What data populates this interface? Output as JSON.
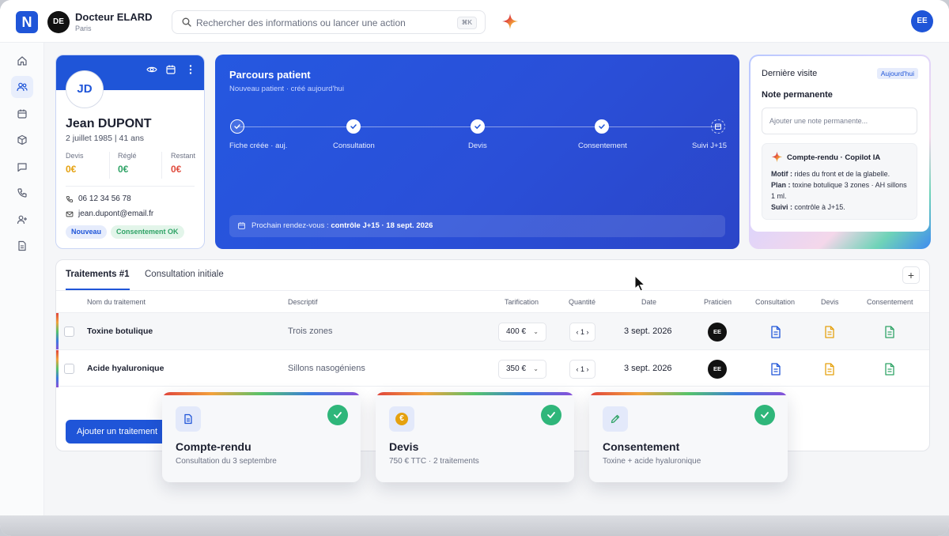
{
  "header": {
    "logo_letter": "N",
    "doctor_initials": "DE",
    "doctor_name": "Docteur ELARD",
    "doctor_city": "Paris",
    "search_placeholder": "Rechercher des informations ou lancer une action",
    "search_shortcut": "⌘K",
    "user_initials": "EE"
  },
  "sidebar": {
    "items": [
      {
        "icon": "home-icon"
      },
      {
        "icon": "users-icon",
        "active": true
      },
      {
        "icon": "calendar-icon"
      },
      {
        "icon": "box-icon"
      },
      {
        "icon": "chat-icon"
      },
      {
        "icon": "phone-icon"
      },
      {
        "icon": "user-plus-icon"
      },
      {
        "icon": "document-icon"
      }
    ]
  },
  "patient": {
    "initials": "JD",
    "name": "Jean DUPONT",
    "dob_age": "2 juillet 1985 | 41 ans",
    "stats": [
      {
        "label": "Devis",
        "value": "0€",
        "color": "#e5a10f"
      },
      {
        "label": "Réglé",
        "value": "0€",
        "color": "#2fa366"
      },
      {
        "label": "Restant",
        "value": "0€",
        "color": "#e04a3c"
      }
    ],
    "phone": "06 12 34 56 78",
    "email": "jean.dupont@email.fr",
    "badges": [
      "Nouveau",
      "Consentement OK"
    ]
  },
  "journey": {
    "title": "Parcours patient",
    "subtitle": "Nouveau patient · créé aujourd'hui",
    "steps": [
      "Fiche créée · auj.",
      "Consultation",
      "Devis",
      "Consentement",
      "Suivi J+15"
    ],
    "next_prefix": "Prochain rendez-vous : ",
    "next_value": "contrôle J+15 · 18 sept. 2026"
  },
  "visit": {
    "title": "Dernière visite",
    "today": "Aujourd'hui",
    "note_title": "Note permanente",
    "note_placeholder": "Ajouter une note permanente...",
    "ai_title": "Compte-rendu · Copilot IA",
    "motif_label": "Motif :",
    "motif": " rides du front et de la glabelle.",
    "plan_label": "Plan :",
    "plan": " toxine botulique 3 zones · AH sillons 1 ml.",
    "suivi_label": "Suivi :",
    "suivi": " contrôle à J+15."
  },
  "treatments": {
    "tabs": [
      "Traitements #1",
      "Consultation initiale"
    ],
    "add_tab": "+",
    "columns": [
      "Nom du traitement",
      "Descriptif",
      "Tarification",
      "Quantité",
      "Date",
      "Praticien",
      "Consultation",
      "Devis",
      "Consentement"
    ],
    "rows": [
      {
        "name": "Toxine botulique",
        "desc": "Trois zones",
        "price": "400 €",
        "qty": "‹ 1 ›",
        "date": "3 sept. 2026",
        "practitioner": "EE"
      },
      {
        "name": "Acide hyaluronique",
        "desc": "Sillons nasogéniens",
        "price": "350 €",
        "qty": "‹ 1 ›",
        "date": "3 sept. 2026",
        "practitioner": "EE"
      }
    ],
    "add_button": "Ajouter un traitement"
  },
  "cards": [
    {
      "title": "Compte-rendu",
      "subtitle": "Consultation du 3 septembre",
      "icon": "document-icon"
    },
    {
      "title": "Devis",
      "subtitle": "750 € TTC · 2 traitements",
      "icon": "euro-icon",
      "icon_text": "€"
    },
    {
      "title": "Consentement",
      "subtitle": "Toxine + acide hyaluronique",
      "icon": "pen-icon"
    }
  ],
  "colors": {
    "brand_blue": "#1f55d8",
    "success_green": "#2fb67a",
    "devis_orange": "#e5a10f",
    "consent_green": "#2fa366"
  }
}
